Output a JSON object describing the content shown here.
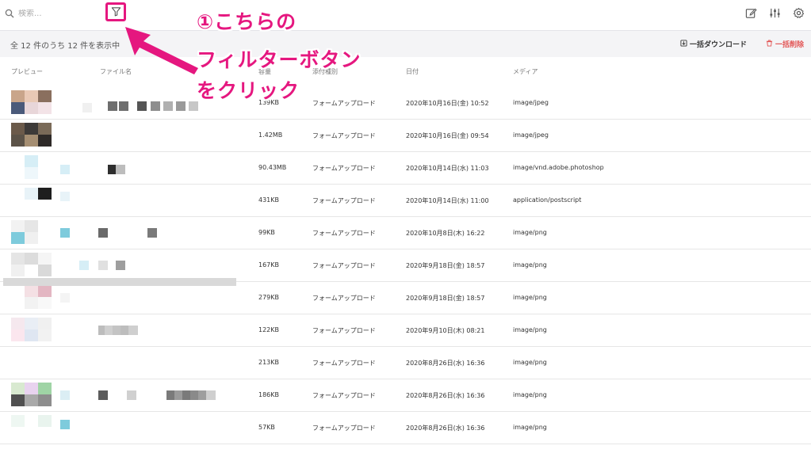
{
  "search": {
    "placeholder": "検索..."
  },
  "icons": {
    "search": "search-icon",
    "filter": "filter-icon",
    "edit": "edit-icon",
    "sliders": "sliders-icon",
    "gear": "gear-icon"
  },
  "summary": {
    "text": "全 12 件のうち 12 件を表示中"
  },
  "actions": {
    "bulk_download": "一括ダウンロード",
    "bulk_delete": "一括削除"
  },
  "columns": {
    "preview": "プレビュー",
    "filename": "ファイル名",
    "size": "容量",
    "attach_type": "添付種別",
    "date": "日付",
    "media": "メディア"
  },
  "rows": [
    {
      "size": "139KB",
      "type": "フォームアップロード",
      "date": "2020年10月16日(金) 10:52",
      "media": "image/jpeg"
    },
    {
      "size": "1.42MB",
      "type": "フォームアップロード",
      "date": "2020年10月16日(金) 09:54",
      "media": "image/jpeg"
    },
    {
      "size": "90.43MB",
      "type": "フォームアップロード",
      "date": "2020年10月14日(水) 11:03",
      "media": "image/vnd.adobe.photoshop"
    },
    {
      "size": "431KB",
      "type": "フォームアップロード",
      "date": "2020年10月14日(水) 11:00",
      "media": "application/postscript"
    },
    {
      "size": "99KB",
      "type": "フォームアップロード",
      "date": "2020年10月8日(木) 16:22",
      "media": "image/png"
    },
    {
      "size": "167KB",
      "type": "フォームアップロード",
      "date": "2020年9月18日(金) 18:57",
      "media": "image/png"
    },
    {
      "size": "279KB",
      "type": "フォームアップロード",
      "date": "2020年9月18日(金) 18:57",
      "media": "image/png"
    },
    {
      "size": "122KB",
      "type": "フォームアップロード",
      "date": "2020年9月10日(木) 08:21",
      "media": "image/png"
    },
    {
      "size": "213KB",
      "type": "フォームアップロード",
      "date": "2020年8月26日(水) 16:36",
      "media": "image/png"
    },
    {
      "size": "186KB",
      "type": "フォームアップロード",
      "date": "2020年8月26日(水) 16:36",
      "media": "image/png"
    },
    {
      "size": "57KB",
      "type": "フォームアップロード",
      "date": "2020年8月26日(水) 16:36",
      "media": "image/png"
    }
  ],
  "annotation": {
    "line1": "①こちらの",
    "line2": "フィルターボタン",
    "line3": "をクリック",
    "color": "#e5177f"
  }
}
